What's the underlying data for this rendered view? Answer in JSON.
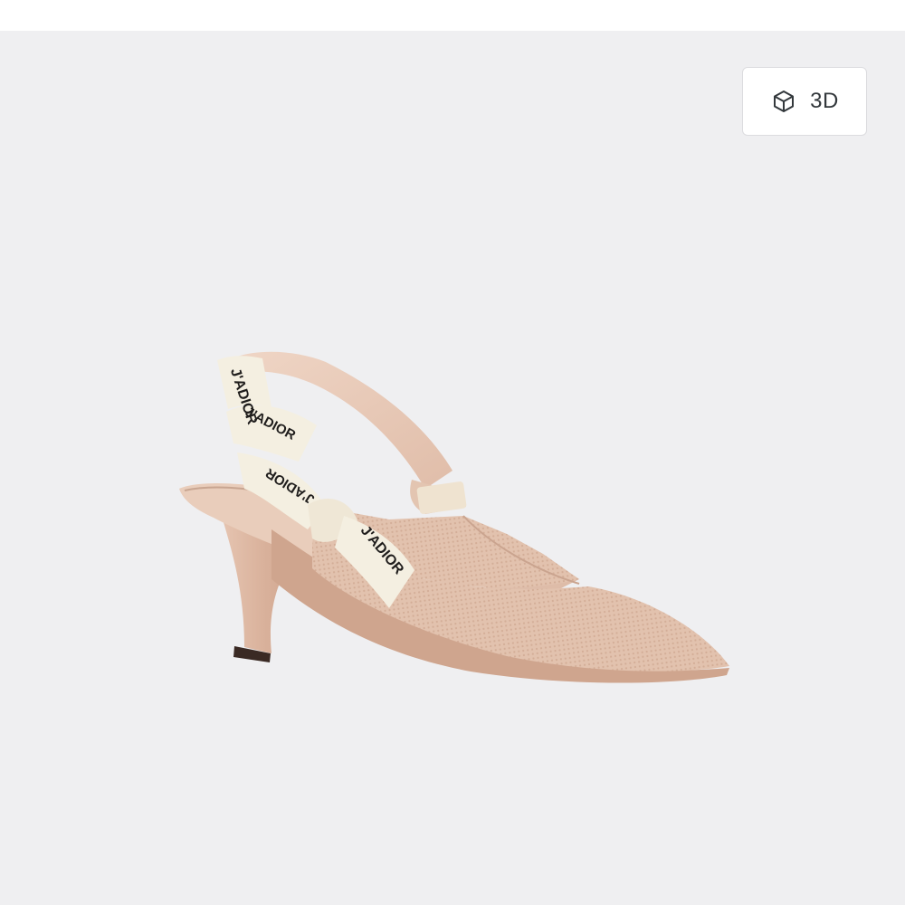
{
  "viewer": {
    "view3d_label": "3D",
    "view3d_icon": "cube-icon"
  },
  "product": {
    "ribbon_text": "J'ADIOR"
  },
  "colors": {
    "stage_background": "#efeff1",
    "button_background": "#ffffff",
    "button_text": "#33383c",
    "shoe_mesh": "#e3c4b1",
    "ribbon": "#f4efe1"
  }
}
